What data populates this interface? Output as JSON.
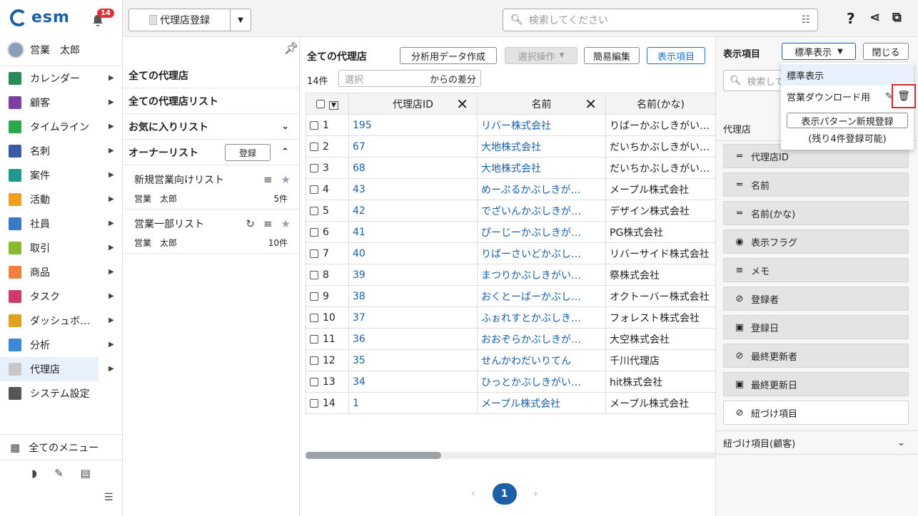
{
  "app": {
    "logo_text": "esm",
    "notif_count": "14",
    "user_name": "営業　太郎"
  },
  "sidebar": {
    "items": [
      {
        "label": "カレンダー",
        "color": "#2a8a5a",
        "icon": "calendar-icon"
      },
      {
        "label": "顧客",
        "color": "#7b3fa0",
        "icon": "building-icon"
      },
      {
        "label": "タイムライン",
        "color": "#2aa84a",
        "icon": "chat-icon"
      },
      {
        "label": "名刺",
        "color": "#3b5ba5",
        "icon": "card-icon"
      },
      {
        "label": "案件",
        "color": "#1f9a8a",
        "icon": "folder-icon"
      },
      {
        "label": "活動",
        "color": "#f0a020",
        "icon": "note-icon"
      },
      {
        "label": "社員",
        "color": "#3a78c8",
        "icon": "person-icon"
      },
      {
        "label": "取引",
        "color": "#8ab830",
        "icon": "document-icon"
      },
      {
        "label": "商品",
        "color": "#f08040",
        "icon": "box-icon"
      },
      {
        "label": "タスク",
        "color": "#d03a6a",
        "icon": "check-icon"
      },
      {
        "label": "ダッシュボ…",
        "color": "#e0a020",
        "icon": "dashboard-icon"
      },
      {
        "label": "分析",
        "color": "#3a8ad8",
        "icon": "chart-icon"
      },
      {
        "label": "代理店",
        "color": "#c8c8c8",
        "icon": "agency-icon"
      },
      {
        "label": "システム設定",
        "color": "#555555",
        "icon": "gear-icon"
      }
    ],
    "all_menu": "全てのメニュー"
  },
  "topbar": {
    "register_label": "代理店登録",
    "search_placeholder": "検索してください"
  },
  "listpanel": {
    "all_agencies": "全ての代理店",
    "all_agency_lists": "全ての代理店リスト",
    "favorites": "お気に入りリスト",
    "owner_list": "オーナーリスト",
    "register": "登録",
    "lists": [
      {
        "name": "新規営業向けリスト",
        "owner": "営業　太郎",
        "count": "5件"
      },
      {
        "name": "営業一部リスト",
        "owner": "営業　太郎",
        "count": "10件"
      }
    ]
  },
  "center": {
    "title": "全ての代理店",
    "btn_export": "分析用データ作成",
    "btn_select": "選択操作",
    "btn_quick": "簡易編集",
    "btn_display": "表示項目",
    "count": "14件",
    "diff_placeholder": "選択",
    "diff_label": "からの差分",
    "columns": [
      "代理店ID",
      "名前",
      "名前(かな)"
    ],
    "rows": [
      {
        "n": "1",
        "id": "195",
        "name": "リバー株式会社",
        "kana": "りばーかぶしきがいしゃ"
      },
      {
        "n": "2",
        "id": "67",
        "name": "大地株式会社",
        "kana": "だいちかぶしきがいしゃ"
      },
      {
        "n": "3",
        "id": "68",
        "name": "大地株式会社",
        "kana": "だいちかぶしきがいしゃ"
      },
      {
        "n": "4",
        "id": "43",
        "name": "めーぷるかぶしきが…",
        "kana": "メープル株式会社"
      },
      {
        "n": "5",
        "id": "42",
        "name": "でざいんかぶしきが…",
        "kana": "デザイン株式会社"
      },
      {
        "n": "6",
        "id": "41",
        "name": "ぴーじーかぶしきが…",
        "kana": "PG株式会社"
      },
      {
        "n": "7",
        "id": "40",
        "name": "りばーさいどかぶし…",
        "kana": "リバーサイド株式会社"
      },
      {
        "n": "8",
        "id": "39",
        "name": "まつりかぶしきがい…",
        "kana": "祭株式会社"
      },
      {
        "n": "9",
        "id": "38",
        "name": "おくとーばーかぶし…",
        "kana": "オクトーバー株式会社"
      },
      {
        "n": "10",
        "id": "37",
        "name": "ふぉれすとかぶしき…",
        "kana": "フォレスト株式会社"
      },
      {
        "n": "11",
        "id": "36",
        "name": "おおぞらかぶしきが…",
        "kana": "大空株式会社"
      },
      {
        "n": "12",
        "id": "35",
        "name": "せんかわだいりてん",
        "kana": "千川代理店"
      },
      {
        "n": "13",
        "id": "34",
        "name": "ひっとかぶしきがい…",
        "kana": "hit株式会社"
      },
      {
        "n": "14",
        "id": "1",
        "name": "メープル株式会社",
        "kana": "メープル株式会社"
      }
    ],
    "page": "1"
  },
  "right": {
    "title": "表示項目",
    "selected": "標準表示",
    "close": "閉じる",
    "search_placeholder": "検索して",
    "section": "代理店",
    "fields": [
      {
        "label": "代理店ID",
        "icon": "text-short-icon"
      },
      {
        "label": "名前",
        "icon": "text-short-icon"
      },
      {
        "label": "名前(かな)",
        "icon": "text-short-icon"
      },
      {
        "label": "表示フラグ",
        "icon": "dropdown-circle-icon"
      },
      {
        "label": "メモ",
        "icon": "text-long-icon"
      },
      {
        "label": "登録者",
        "icon": "link-icon"
      },
      {
        "label": "登録日",
        "icon": "calendar-icon"
      },
      {
        "label": "最終更新者",
        "icon": "link-icon"
      },
      {
        "label": "最終更新日",
        "icon": "calendar-icon"
      },
      {
        "label": "紐づけ項目",
        "icon": "link-icon"
      }
    ],
    "section2": "紐づけ項目(顧客)"
  },
  "dropdown": {
    "items": [
      "標準表示",
      "営業ダウンロード用"
    ],
    "new_pattern": "表示パターン新規登録",
    "note": "(残り4件登録可能)"
  }
}
